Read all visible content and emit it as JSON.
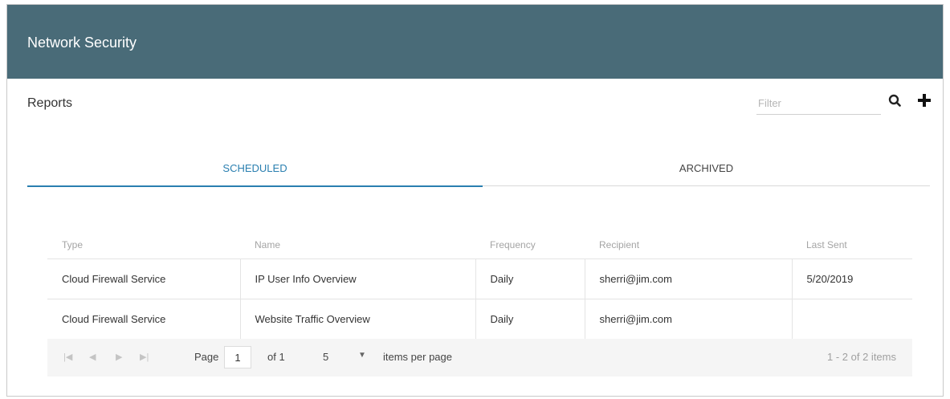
{
  "header": {
    "title": "Network Security"
  },
  "reports": {
    "title": "Reports"
  },
  "filter": {
    "placeholder": "Filter"
  },
  "icons": {
    "search": "search-icon",
    "add": "plus-icon"
  },
  "colors": {
    "header_bg": "#496b78",
    "accent": "#2a7fb0"
  },
  "tabs": [
    {
      "label": "SCHEDULED",
      "active": true
    },
    {
      "label": "ARCHIVED",
      "active": false
    }
  ],
  "table": {
    "columns": [
      "Type",
      "Name",
      "Frequency",
      "Recipient",
      "Last Sent"
    ],
    "rows": [
      [
        "Cloud Firewall Service",
        "IP User Info Overview",
        "Daily",
        "sherri@jim.com",
        "5/20/2019"
      ],
      [
        "Cloud Firewall Service",
        "Website Traffic Overview",
        "Daily",
        "sherri@jim.com",
        ""
      ]
    ]
  },
  "pager": {
    "page_label": "Page",
    "page_value": "1",
    "of_label": "of 1",
    "page_size": "5",
    "per_page_label": "items per page",
    "info": "1 - 2 of 2 items"
  }
}
